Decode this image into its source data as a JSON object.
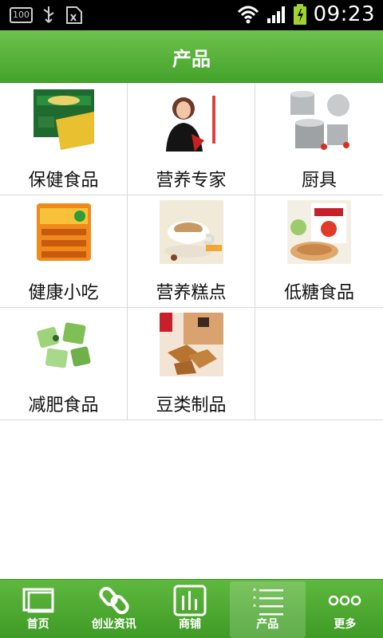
{
  "status_bar": {
    "time": "09:23",
    "left_box_text": "100"
  },
  "header": {
    "title": "产品"
  },
  "grid": {
    "items": [
      {
        "label": "保健食品"
      },
      {
        "label": "营养专家"
      },
      {
        "label": "厨具"
      },
      {
        "label": "健康小吃"
      },
      {
        "label": "营养糕点"
      },
      {
        "label": "低糖食品"
      },
      {
        "label": "减肥食品"
      },
      {
        "label": "豆类制品"
      }
    ]
  },
  "bottom_nav": {
    "tabs": [
      {
        "label": "首页"
      },
      {
        "label": "创业资讯"
      },
      {
        "label": "商铺"
      },
      {
        "label": "产品"
      },
      {
        "label": "更多"
      }
    ]
  },
  "colors": {
    "accent": "#4fae32"
  }
}
